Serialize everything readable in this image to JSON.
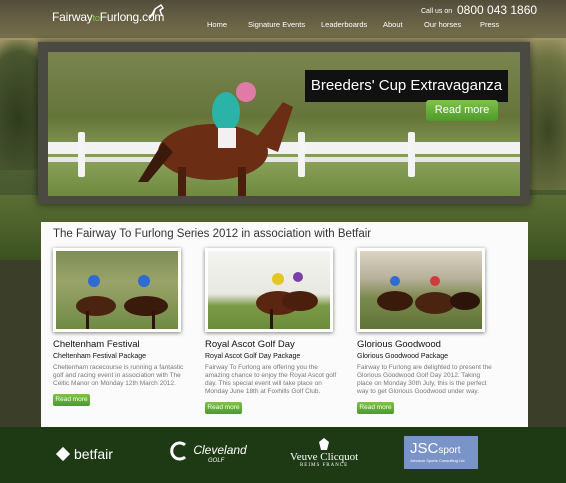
{
  "header": {
    "logo_left": "Fairway",
    "logo_to": "to",
    "logo_right": "Furlong.com",
    "call_us": "Call us on",
    "phone": "0800 043 1860",
    "nav": [
      "Home",
      "Signature Events",
      "Leaderboards",
      "About",
      "Our horses",
      "Press"
    ]
  },
  "hero": {
    "title": "Breeders' Cup Extravaganza",
    "button": "Read more"
  },
  "section": {
    "title": "The Fairway To Furlong Series 2012 in association with Betfair",
    "cards": [
      {
        "title": "Cheltenham Festival",
        "subtitle": "Cheltenham Festival Package",
        "text": "Cheltenham racecourse is running a fantastic golf and racing event in association with The Celtic Manor on Monday 12th March 2012.",
        "button": "Read more"
      },
      {
        "title": "Royal Ascot Golf Day",
        "subtitle": "Royal Ascot Golf Day Package",
        "text": "Fairway To Furlong are offering you the amazing chance to enjoy the Royal Ascot golf day. This special event will take place on Monday June 18th at Foxhills Golf Club.",
        "button": "Read more"
      },
      {
        "title": "Glorious Goodwood",
        "subtitle": "Glorious Goodwood Package",
        "text": "Fairway to Furlong are delighted to present the Glorious Goodwood Golf Day 2012. Taking place on Monday 30th July, this is the perfect way to get Glorious Goodwood under way.",
        "button": "Read more"
      }
    ]
  },
  "sponsors": {
    "betfair": "betfair",
    "cleveland": "Cleveland",
    "cleveland_sub": "GOLF",
    "veuve": "Veuve Clicquot",
    "veuve_sub": "REIMS FRANCE",
    "jsc": "JSC",
    "jsc_word": "sport",
    "jsc_sub": "Johnson Sports Consulting Ltd"
  },
  "colors": {
    "accent_green": "#5aa834",
    "footer": "#1d3a14"
  }
}
